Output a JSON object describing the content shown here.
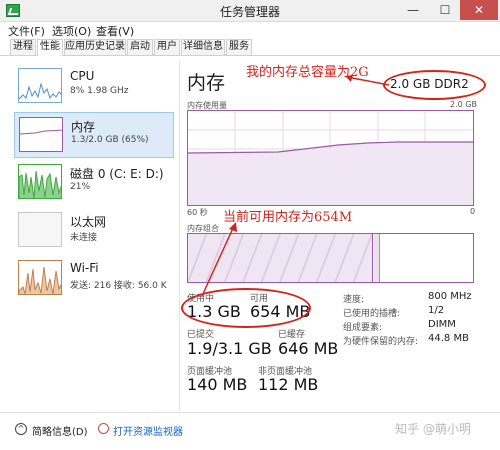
{
  "window": {
    "title": "任务管理器",
    "minimize": "—",
    "maximize": "☐",
    "close": "✕"
  },
  "menu": [
    "文件(F)",
    "选项(O)",
    "查看(V)"
  ],
  "tabs": [
    "进程",
    "性能",
    "应用历史记录",
    "启动",
    "用户",
    "详细信息",
    "服务"
  ],
  "sidebar": [
    {
      "name": "CPU",
      "sub": "8% 1.98 GHz"
    },
    {
      "name": "内存",
      "sub": "1.3/2.0 GB (65%)"
    },
    {
      "name": "磁盘 0 (C: E: D:)",
      "sub": "21%"
    },
    {
      "name": "以太网",
      "sub": "未连接"
    },
    {
      "name": "Wi-Fi",
      "sub": "发送: 216 接收: 56.0 K"
    }
  ],
  "memory": {
    "title": "内存",
    "total": "2.0 GB DDR2",
    "usage_label": "内存使用量",
    "usage_max": "2.0 GB",
    "time_label": "60 秒",
    "time_zero": "0",
    "composition_label": "内存组合",
    "in_use_fraction": 0.65,
    "in_use_label": "使用中",
    "in_use_value": "1.3 GB",
    "available_label": "可用",
    "available_value": "654 MB",
    "committed_label": "已提交",
    "committed_value": "1.9/3.1 GB",
    "cached_label": "已缓存",
    "cached_value": "646 MB",
    "paged_label": "页面缓冲池",
    "paged_value": "140 MB",
    "nonpaged_label": "非页面缓冲池",
    "nonpaged_value": "112 MB",
    "details": [
      {
        "label": "速度:",
        "value": "800 MHz"
      },
      {
        "label": "已使用的插槽:",
        "value": "1/2"
      },
      {
        "label": "组成要素:",
        "value": "DIMM"
      },
      {
        "label": "为硬件保留的内存:",
        "value": "44.8 MB"
      }
    ]
  },
  "annotations": {
    "total_note": "我的内存总容量为2G",
    "available_note": "当前可用内存为654M"
  },
  "footer": {
    "brief": "简略信息(D)",
    "monitor": "打开资源监视器"
  },
  "watermark": "知乎 @萌小明",
  "colors": {
    "memory": "#9a5aa6",
    "cpu": "#4f8fd1",
    "disk": "#3ea83e",
    "wifi": "#c0804d",
    "annotation": "#d4251d"
  }
}
